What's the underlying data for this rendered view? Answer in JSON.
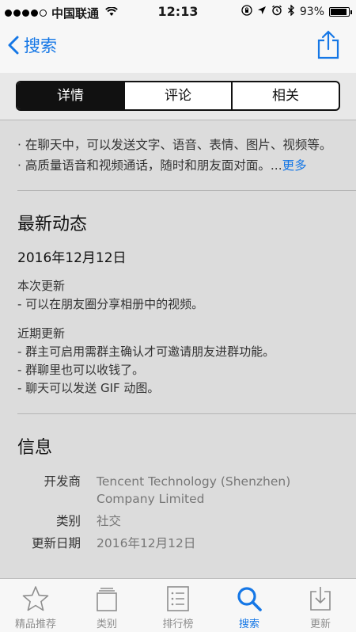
{
  "status_bar": {
    "carrier": "中国联通",
    "time": "12:13",
    "battery": "93%",
    "battery_level": 0.93
  },
  "nav": {
    "back_label": "搜索"
  },
  "segments": [
    {
      "label": "详情",
      "active": true
    },
    {
      "label": "评论",
      "active": false
    },
    {
      "label": "相关",
      "active": false
    }
  ],
  "description": {
    "line1": "· 在聊天中，可以发送文字、语音、表情、图片、视频等。",
    "line2": "· 高质量语音和视频通话，随时和朋友面对面。...",
    "more": "更多"
  },
  "whats_new": {
    "title": "最新动态",
    "date": "2016年12月12日",
    "current_heading": "本次更新",
    "current_items": [
      "- 可以在朋友圈分享相册中的视频。"
    ],
    "recent_heading": "近期更新",
    "recent_items": [
      "- 群主可启用需群主确认才可邀请朋友进群功能。",
      "- 群聊里也可以收钱了。",
      "- 聊天可以发送 GIF 动图。"
    ]
  },
  "info": {
    "title": "信息",
    "rows": [
      {
        "key": "开发商",
        "value": "Tencent Technology (Shenzhen) Company Limited"
      },
      {
        "key": "类别",
        "value": "社交"
      },
      {
        "key": "更新日期",
        "value": "2016年12月12日"
      }
    ]
  },
  "tab_bar": [
    {
      "label": "精品推荐",
      "icon": "star-icon",
      "active": false
    },
    {
      "label": "类别",
      "icon": "categories-icon",
      "active": false
    },
    {
      "label": "排行榜",
      "icon": "top-charts-icon",
      "active": false
    },
    {
      "label": "搜索",
      "icon": "search-icon",
      "active": true
    },
    {
      "label": "更新",
      "icon": "updates-icon",
      "active": false
    }
  ]
}
